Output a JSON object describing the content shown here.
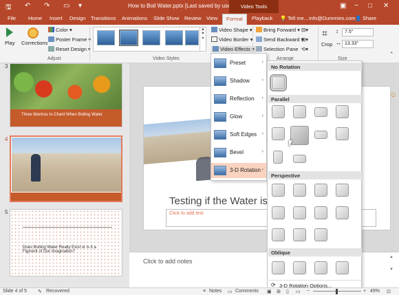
{
  "titlebar": {
    "title": "How to Boil Water.pptx [Last saved by user] - PowerPoi...",
    "contextual": "Video Tools",
    "window_buttons": [
      "−",
      "□",
      "✕"
    ]
  },
  "tabs": [
    "File",
    "Home",
    "Insert",
    "Design",
    "Transitions",
    "Animations",
    "Slide Show",
    "Review",
    "View",
    "Format",
    "Playback"
  ],
  "active_tab": "Format",
  "tell_me": "Tell me...",
  "account": "info@Dummies.com",
  "share": "Share",
  "ribbon": {
    "play": "Play",
    "corrections": "Corrections",
    "color": "Color",
    "poster_frame": "Poster Frame",
    "reset_design": "Reset Design",
    "adjust_label": "Adjust",
    "video_styles_label": "Video Styles",
    "video_shape": "Video Shape",
    "video_border": "Video Border",
    "video_effects": "Video Effects",
    "bring_forward": "Bring Forward",
    "send_backward": "Send Backward",
    "selection_pane": "Selection Pane",
    "arrange_label": "Arrange",
    "crop": "Crop",
    "height": "7.5\"",
    "width": "13.33\"",
    "size_label": "Size"
  },
  "slides": [
    {
      "num": "3",
      "text": "Three Mantras to Chant When Boiling Water"
    },
    {
      "num": "4",
      "text": ""
    },
    {
      "num": "5",
      "text": "Does Boiling Water Really Exist or is it a Figment of Our Imagination?"
    }
  ],
  "editor": {
    "slide_title": "Testing if the Water is Bo",
    "add_text": "Click to add text",
    "notes": "Click to add notes"
  },
  "video_effects_menu": [
    "Preset",
    "Shadow",
    "Reflection",
    "Glow",
    "Soft Edges",
    "Bevel",
    "3-D Rotation"
  ],
  "rotation_menu": {
    "sections": [
      "No Rotation",
      "Parallel",
      "Perspective",
      "Oblique"
    ],
    "footer": "3-D Rotation Options..."
  },
  "status": {
    "slide": "Slide 4 of 5",
    "recovered": "Recovered",
    "notes": "Notes",
    "comments": "Comments",
    "zoom": "49%"
  }
}
